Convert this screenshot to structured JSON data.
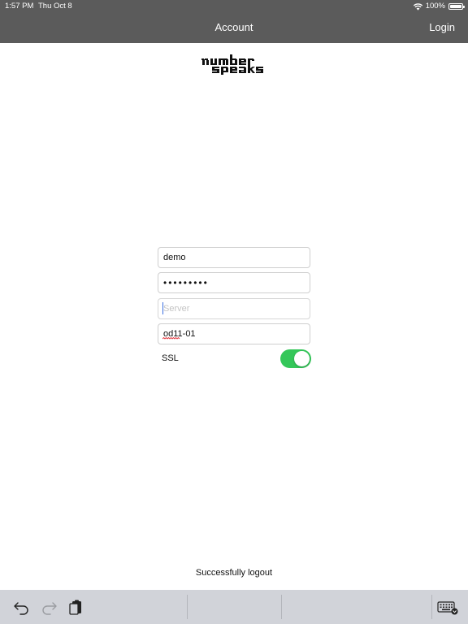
{
  "status_bar": {
    "time": "1:57 PM",
    "date": "Thu Oct 8",
    "battery": "100%"
  },
  "nav": {
    "title": "Account",
    "login_label": "Login"
  },
  "form": {
    "username": "demo",
    "password": "•••••••••",
    "server_placeholder": "Server",
    "server_value": "",
    "port": "od11-01",
    "ssl_label": "SSL",
    "ssl_enabled": true
  },
  "message": "Successfully logout",
  "colors": {
    "nav_bg": "#5b5b5b",
    "switch_on": "#34c759",
    "keyboard_bar": "#d1d3d9"
  },
  "keyboard_bar_icons": [
    "undo-icon",
    "redo-icon",
    "paste-icon",
    "keyboard-dismiss-icon"
  ]
}
